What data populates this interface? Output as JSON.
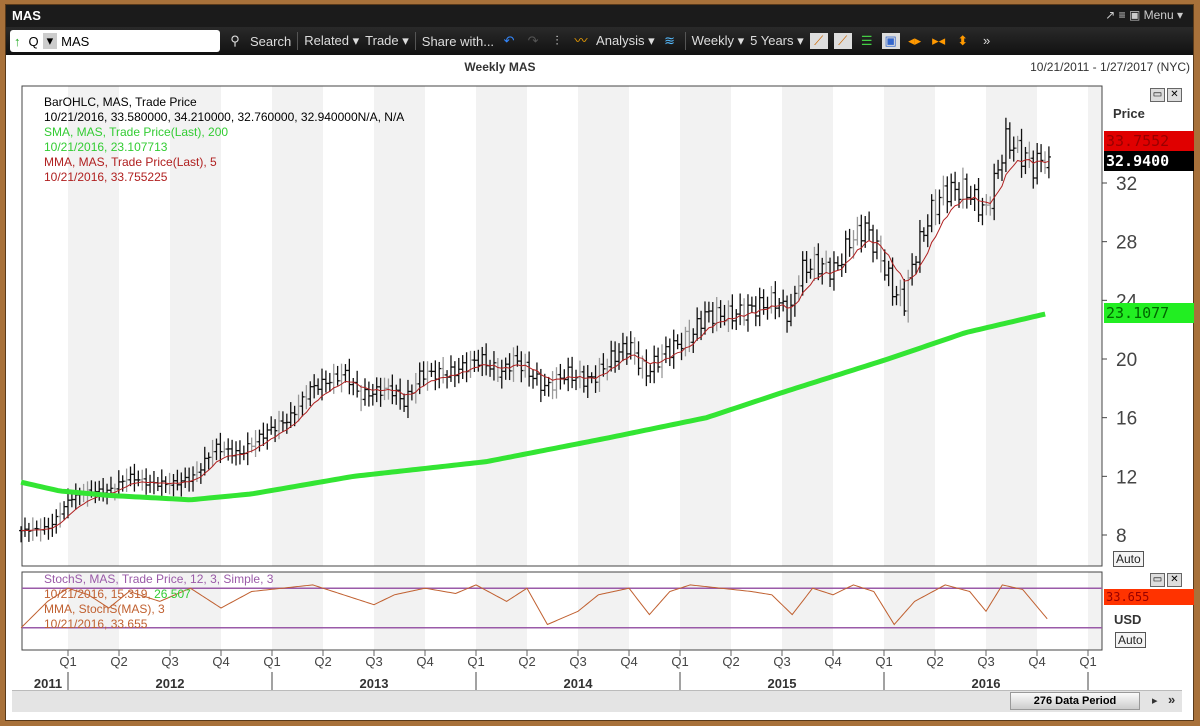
{
  "window": {
    "title": "MAS",
    "controls": "↗ ≡ ▣ Menu ▾"
  },
  "toolbar": {
    "ticker_type": "Q",
    "symbol": "MAS",
    "search": "Search",
    "related": "Related ▾",
    "trade": "Trade ▾",
    "share": "Share with...",
    "analysis": "Analysis ▾",
    "interval": "Weekly ▾",
    "span": "5 Years ▾"
  },
  "chart": {
    "title": "Weekly MAS",
    "date_range": "10/21/2011 - 1/27/2017 (NYC)"
  },
  "legend": {
    "bar_title": "BarOHLC, MAS, Trade Price",
    "bar_values": "10/21/2016, 33.580000, 34.210000, 32.760000, 32.940000N/A, N/A",
    "sma_title": "SMA, MAS, Trade Price(Last),  200",
    "sma_values": "10/21/2016, 23.107713",
    "mma_title": "MMA, MAS, Trade Price(Last),  5",
    "mma_values": "10/21/2016, 33.755225",
    "stoch_title": "StochS, MAS, Trade Price,  12, 3, Simple, 3",
    "stoch_values_date": "10/21/2016, 15.319, ",
    "stoch_values_d": "26.507",
    "stoch_mma_title": "MMA, StochS(MAS),  3",
    "stoch_mma_values": "10/21/2016, 33.655"
  },
  "axis": {
    "price_label": "Price",
    "mma_tag": "33.7552",
    "last_tag": "32.9400",
    "sma_tag": "23.1077",
    "stoch_tag": "33.655",
    "currency": "USD",
    "auto": "Auto"
  },
  "footer": {
    "period": "276 Data Period"
  },
  "colors": {
    "sma": "#33e533",
    "mma": "#b02020",
    "stoch": "#c06030",
    "band": "#9a5aa8",
    "red_tag": "#e00000",
    "green_tag": "#22ee22",
    "stoch_tag": "#ff3300"
  },
  "chart_data": {
    "type": "ohlc",
    "title": "Weekly MAS",
    "ylabel": "Price",
    "ylim": [
      6,
      36
    ],
    "yticks": [
      8,
      12,
      16,
      20,
      24,
      28,
      32
    ],
    "quarter_ticks": [
      "Q1",
      "Q2",
      "Q3",
      "Q4",
      "Q1",
      "Q2",
      "Q3",
      "Q4",
      "Q1",
      "Q2",
      "Q3",
      "Q4",
      "Q1",
      "Q2",
      "Q3",
      "Q4",
      "Q1",
      "Q2",
      "Q3",
      "Q4",
      "Q1"
    ],
    "years": [
      "2011",
      "2012",
      "2013",
      "2014",
      "2015",
      "2016"
    ],
    "close_anchors": [
      [
        2011.77,
        8.3
      ],
      [
        2011.91,
        8.5
      ],
      [
        2012.01,
        10.5
      ],
      [
        2012.11,
        11
      ],
      [
        2012.2,
        11
      ],
      [
        2012.3,
        12
      ],
      [
        2012.4,
        11.5
      ],
      [
        2012.52,
        11.5
      ],
      [
        2012.62,
        12
      ],
      [
        2012.72,
        14
      ],
      [
        2012.84,
        13.5
      ],
      [
        2012.97,
        15
      ],
      [
        2013.09,
        16
      ],
      [
        2013.19,
        18
      ],
      [
        2013.36,
        19
      ],
      [
        2013.43,
        17.5
      ],
      [
        2013.58,
        18
      ],
      [
        2013.65,
        17
      ],
      [
        2013.73,
        19
      ],
      [
        2013.87,
        19
      ],
      [
        2014.02,
        20
      ],
      [
        2014.12,
        19
      ],
      [
        2014.19,
        20
      ],
      [
        2014.34,
        18
      ],
      [
        2014.44,
        19
      ],
      [
        2014.56,
        18.5
      ],
      [
        2014.66,
        20
      ],
      [
        2014.75,
        21
      ],
      [
        2014.83,
        19
      ],
      [
        2014.93,
        20.5
      ],
      [
        2015.05,
        21.5
      ],
      [
        2015.12,
        23
      ],
      [
        2015.25,
        23
      ],
      [
        2015.37,
        23.5
      ],
      [
        2015.47,
        24
      ],
      [
        2015.54,
        23
      ],
      [
        2015.59,
        26
      ],
      [
        2015.66,
        26.5
      ],
      [
        2015.76,
        26
      ],
      [
        2015.83,
        28
      ],
      [
        2015.91,
        29
      ],
      [
        2015.98,
        27
      ],
      [
        2016.05,
        24.5
      ],
      [
        2016.1,
        24
      ],
      [
        2016.15,
        27
      ],
      [
        2016.23,
        30
      ],
      [
        2016.3,
        31.5
      ],
      [
        2016.4,
        31.5
      ],
      [
        2016.5,
        30
      ],
      [
        2016.56,
        33
      ],
      [
        2016.6,
        35
      ],
      [
        2016.67,
        34
      ],
      [
        2016.74,
        33
      ],
      [
        2016.78,
        34
      ],
      [
        2016.8,
        32.94
      ]
    ],
    "sma200": [
      [
        2011.77,
        11.6
      ],
      [
        2011.96,
        11
      ],
      [
        2012.2,
        10.7
      ],
      [
        2012.6,
        10.4
      ],
      [
        2012.9,
        10.8
      ],
      [
        2013.4,
        12
      ],
      [
        2014.05,
        13
      ],
      [
        2014.64,
        14.6
      ],
      [
        2015.13,
        16
      ],
      [
        2015.52,
        17.8
      ],
      [
        2016.02,
        20
      ],
      [
        2016.4,
        21.8
      ],
      [
        2016.8,
        23.1
      ]
    ],
    "stoch_mma": [
      [
        2011.77,
        20
      ],
      [
        2011.9,
        60
      ],
      [
        2012.0,
        80
      ],
      [
        2012.1,
        70
      ],
      [
        2012.2,
        50
      ],
      [
        2012.3,
        75
      ],
      [
        2012.45,
        60
      ],
      [
        2012.6,
        80
      ],
      [
        2012.75,
        50
      ],
      [
        2012.9,
        75
      ],
      [
        2013.05,
        80
      ],
      [
        2013.2,
        85
      ],
      [
        2013.35,
        70
      ],
      [
        2013.5,
        55
      ],
      [
        2013.6,
        70
      ],
      [
        2013.75,
        80
      ],
      [
        2013.9,
        72
      ],
      [
        2014.0,
        85
      ],
      [
        2014.15,
        60
      ],
      [
        2014.25,
        80
      ],
      [
        2014.35,
        25
      ],
      [
        2014.5,
        45
      ],
      [
        2014.6,
        70
      ],
      [
        2014.75,
        80
      ],
      [
        2014.85,
        40
      ],
      [
        2014.95,
        75
      ],
      [
        2015.05,
        85
      ],
      [
        2015.2,
        80
      ],
      [
        2015.35,
        75
      ],
      [
        2015.45,
        70
      ],
      [
        2015.55,
        40
      ],
      [
        2015.65,
        80
      ],
      [
        2015.75,
        70
      ],
      [
        2015.85,
        85
      ],
      [
        2015.95,
        75
      ],
      [
        2016.05,
        25
      ],
      [
        2016.15,
        60
      ],
      [
        2016.3,
        85
      ],
      [
        2016.42,
        75
      ],
      [
        2016.5,
        45
      ],
      [
        2016.58,
        85
      ],
      [
        2016.68,
        78
      ],
      [
        2016.8,
        33.655
      ]
    ]
  }
}
